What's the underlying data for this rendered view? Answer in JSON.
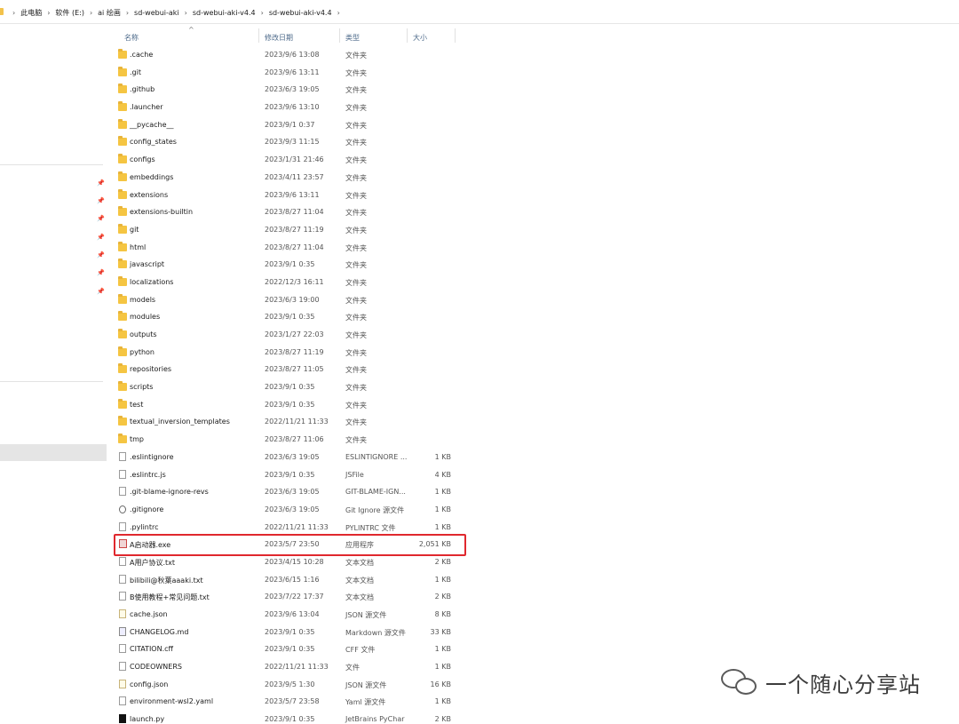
{
  "breadcrumb": [
    "此电脑",
    "软件 (E:)",
    "ai 绘画",
    "sd-webui-aki",
    "sd-webui-aki-v4.4",
    "sd-webui-aki-v4.4"
  ],
  "columns": {
    "name": "名称",
    "date": "修改日期",
    "type": "类型",
    "size": "大小"
  },
  "files": [
    {
      "name": ".cache",
      "date": "2023/9/6 13:08",
      "type": "文件夹",
      "size": "",
      "icon": "folder"
    },
    {
      "name": ".git",
      "date": "2023/9/6 13:11",
      "type": "文件夹",
      "size": "",
      "icon": "folder"
    },
    {
      "name": ".github",
      "date": "2023/6/3 19:05",
      "type": "文件夹",
      "size": "",
      "icon": "folder"
    },
    {
      "name": ".launcher",
      "date": "2023/9/6 13:10",
      "type": "文件夹",
      "size": "",
      "icon": "folder"
    },
    {
      "name": "__pycache__",
      "date": "2023/9/1 0:37",
      "type": "文件夹",
      "size": "",
      "icon": "folder"
    },
    {
      "name": "config_states",
      "date": "2023/9/3 11:15",
      "type": "文件夹",
      "size": "",
      "icon": "folder"
    },
    {
      "name": "configs",
      "date": "2023/1/31 21:46",
      "type": "文件夹",
      "size": "",
      "icon": "folder"
    },
    {
      "name": "embeddings",
      "date": "2023/4/11 23:57",
      "type": "文件夹",
      "size": "",
      "icon": "folder"
    },
    {
      "name": "extensions",
      "date": "2023/9/6 13:11",
      "type": "文件夹",
      "size": "",
      "icon": "folder"
    },
    {
      "name": "extensions-builtin",
      "date": "2023/8/27 11:04",
      "type": "文件夹",
      "size": "",
      "icon": "folder"
    },
    {
      "name": "git",
      "date": "2023/8/27 11:19",
      "type": "文件夹",
      "size": "",
      "icon": "folder"
    },
    {
      "name": "html",
      "date": "2023/8/27 11:04",
      "type": "文件夹",
      "size": "",
      "icon": "folder"
    },
    {
      "name": "javascript",
      "date": "2023/9/1 0:35",
      "type": "文件夹",
      "size": "",
      "icon": "folder"
    },
    {
      "name": "localizations",
      "date": "2022/12/3 16:11",
      "type": "文件夹",
      "size": "",
      "icon": "folder"
    },
    {
      "name": "models",
      "date": "2023/6/3 19:00",
      "type": "文件夹",
      "size": "",
      "icon": "folder"
    },
    {
      "name": "modules",
      "date": "2023/9/1 0:35",
      "type": "文件夹",
      "size": "",
      "icon": "folder"
    },
    {
      "name": "outputs",
      "date": "2023/1/27 22:03",
      "type": "文件夹",
      "size": "",
      "icon": "folder"
    },
    {
      "name": "python",
      "date": "2023/8/27 11:19",
      "type": "文件夹",
      "size": "",
      "icon": "folder"
    },
    {
      "name": "repositories",
      "date": "2023/8/27 11:05",
      "type": "文件夹",
      "size": "",
      "icon": "folder"
    },
    {
      "name": "scripts",
      "date": "2023/9/1 0:35",
      "type": "文件夹",
      "size": "",
      "icon": "folder"
    },
    {
      "name": "test",
      "date": "2023/9/1 0:35",
      "type": "文件夹",
      "size": "",
      "icon": "folder"
    },
    {
      "name": "textual_inversion_templates",
      "date": "2022/11/21 11:33",
      "type": "文件夹",
      "size": "",
      "icon": "folder"
    },
    {
      "name": "tmp",
      "date": "2023/8/27 11:06",
      "type": "文件夹",
      "size": "",
      "icon": "folder"
    },
    {
      "name": ".eslintignore",
      "date": "2023/6/3 19:05",
      "type": "ESLINTIGNORE ...",
      "size": "1 KB",
      "icon": "file"
    },
    {
      "name": ".eslintrc.js",
      "date": "2023/9/1 0:35",
      "type": "JSFile",
      "size": "4 KB",
      "icon": "file"
    },
    {
      "name": ".git-blame-ignore-revs",
      "date": "2023/6/3 19:05",
      "type": "GIT-BLAME-IGN...",
      "size": "1 KB",
      "icon": "file"
    },
    {
      "name": ".gitignore",
      "date": "2023/6/3 19:05",
      "type": "Git Ignore 源文件",
      "size": "1 KB",
      "icon": "gitig"
    },
    {
      "name": ".pylintrc",
      "date": "2022/11/21 11:33",
      "type": "PYLINTRC 文件",
      "size": "1 KB",
      "icon": "file"
    },
    {
      "name": "A启动器.exe",
      "date": "2023/5/7 23:50",
      "type": "应用程序",
      "size": "2,051 KB",
      "icon": "exe"
    },
    {
      "name": "A用户协议.txt",
      "date": "2023/4/15 10:28",
      "type": "文本文档",
      "size": "2 KB",
      "icon": "file"
    },
    {
      "name": "bilibili@秋葉aaaki.txt",
      "date": "2023/6/15 1:16",
      "type": "文本文档",
      "size": "1 KB",
      "icon": "file"
    },
    {
      "name": "B使用教程+常见问题.txt",
      "date": "2023/7/22 17:37",
      "type": "文本文档",
      "size": "2 KB",
      "icon": "file"
    },
    {
      "name": "cache.json",
      "date": "2023/9/6 13:04",
      "type": "JSON 源文件",
      "size": "8 KB",
      "icon": "json"
    },
    {
      "name": "CHANGELOG.md",
      "date": "2023/9/1 0:35",
      "type": "Markdown 源文件",
      "size": "33 KB",
      "icon": "md"
    },
    {
      "name": "CITATION.cff",
      "date": "2023/9/1 0:35",
      "type": "CFF 文件",
      "size": "1 KB",
      "icon": "file"
    },
    {
      "name": "CODEOWNERS",
      "date": "2022/11/21 11:33",
      "type": "文件",
      "size": "1 KB",
      "icon": "file"
    },
    {
      "name": "config.json",
      "date": "2023/9/5 1:30",
      "type": "JSON 源文件",
      "size": "16 KB",
      "icon": "json"
    },
    {
      "name": "environment-wsl2.yaml",
      "date": "2023/5/7 23:58",
      "type": "Yaml 源文件",
      "size": "1 KB",
      "icon": "file"
    },
    {
      "name": "launch.py",
      "date": "2023/9/1 0:35",
      "type": "JetBrains PyChar",
      "size": "2 KB",
      "icon": "py"
    }
  ],
  "watermark": {
    "text": "一个随心分享站",
    "icon": "wechat-icon"
  },
  "colors": {
    "highlight": "#e0282e",
    "folder": "#f5c542"
  }
}
